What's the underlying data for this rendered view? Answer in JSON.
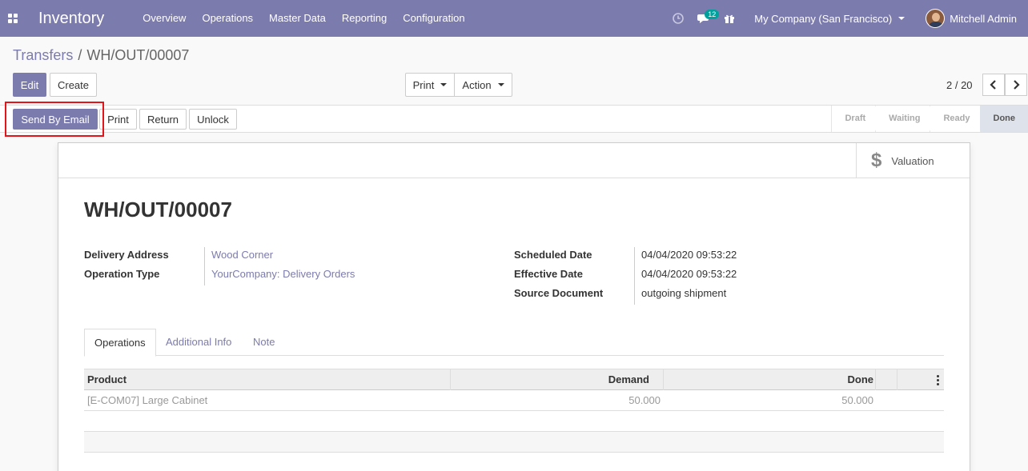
{
  "navbar": {
    "app_title": "Inventory",
    "menu": [
      "Overview",
      "Operations",
      "Master Data",
      "Reporting",
      "Configuration"
    ],
    "messages_count": "12",
    "company": "My Company (San Francisco)",
    "user": "Mitchell Admin",
    "color": "#7c7bad"
  },
  "breadcrumb": {
    "parent": "Transfers",
    "separator": "/",
    "current": "WH/OUT/00007"
  },
  "controls": {
    "edit": "Edit",
    "create": "Create",
    "print": "Print",
    "action": "Action",
    "pager": "2 / 20"
  },
  "statusbar": {
    "buttons": {
      "send_email": "Send By Email",
      "print": "Print",
      "return": "Return",
      "unlock": "Unlock"
    },
    "stages": [
      "Draft",
      "Waiting",
      "Ready",
      "Done"
    ],
    "active_stage": "Done"
  },
  "sheet": {
    "valuation": "Valuation",
    "title": "WH/OUT/00007",
    "left_fields": [
      {
        "label": "Delivery Address",
        "value": "Wood Corner"
      },
      {
        "label": "Operation Type",
        "value": "YourCompany: Delivery Orders"
      }
    ],
    "right_fields": [
      {
        "label": "Scheduled Date",
        "value": "04/04/2020 09:53:22"
      },
      {
        "label": "Effective Date",
        "value": "04/04/2020 09:53:22"
      },
      {
        "label": "Source Document",
        "value": "outgoing shipment"
      }
    ],
    "tabs": [
      "Operations",
      "Additional Info",
      "Note"
    ],
    "table": {
      "columns": [
        "Product",
        "Demand",
        "Done"
      ],
      "rows": [
        {
          "product": "[E-COM07] Large Cabinet",
          "demand": "50.000",
          "done": "50.000"
        }
      ]
    }
  }
}
